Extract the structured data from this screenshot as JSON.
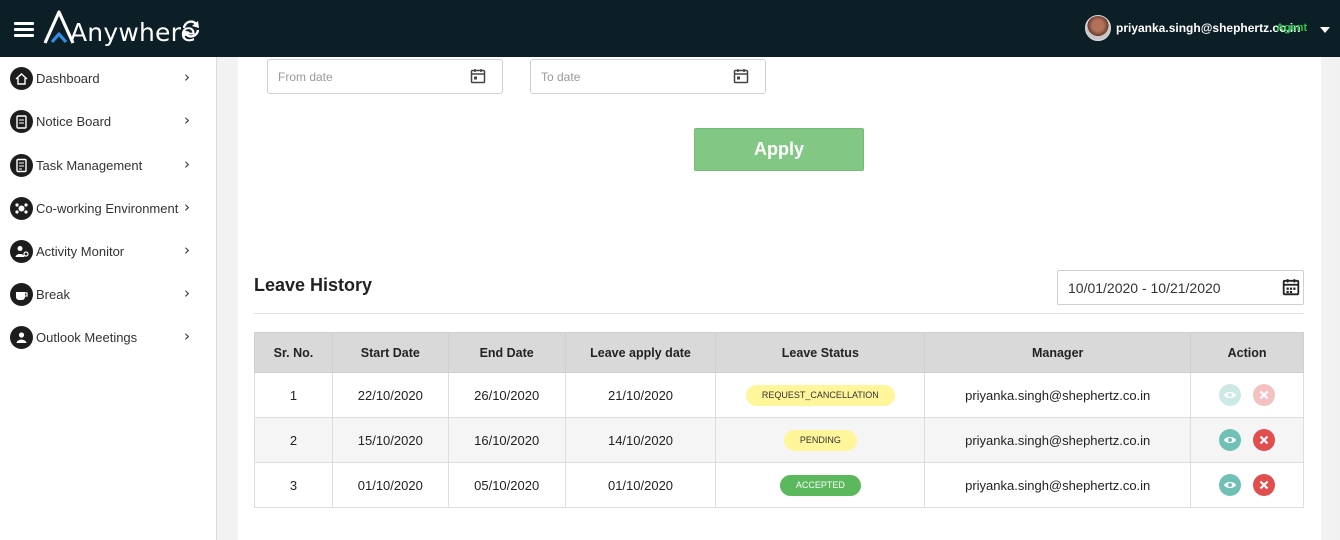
{
  "header": {
    "app_name": "Anywhere",
    "user_email": "priyanka.singh@shephertz.co.in",
    "user_role": "Agent",
    "icons": [
      "menu-icon",
      "refresh-icon",
      "caret-down-icon"
    ]
  },
  "sidebar": {
    "items": [
      {
        "label": "Dashboard",
        "icon": "home-icon"
      },
      {
        "label": "Notice Board",
        "icon": "clipboard-icon"
      },
      {
        "label": "Task Management",
        "icon": "task-icon"
      },
      {
        "label": "Co-working Environment",
        "icon": "coworking-icon"
      },
      {
        "label": "Activity Monitor",
        "icon": "activity-icon"
      },
      {
        "label": "Break",
        "icon": "coffee-icon"
      },
      {
        "label": "Outlook Meetings",
        "icon": "meetings-icon"
      }
    ]
  },
  "filters": {
    "from_placeholder": "From date",
    "to_placeholder": "To date",
    "apply_label": "Apply"
  },
  "history": {
    "title": "Leave History",
    "date_range": "10/01/2020 - 10/21/2020",
    "columns": [
      "Sr. No.",
      "Start Date",
      "End Date",
      "Leave apply date",
      "Leave Status",
      "Manager",
      "Action"
    ],
    "rows": [
      {
        "sr": "1",
        "start": "22/10/2020",
        "end": "26/10/2020",
        "applied": "21/10/2020",
        "status": "REQUEST_CANCELLATION",
        "manager": "priyanka.singh@shephertz.co.in"
      },
      {
        "sr": "2",
        "start": "15/10/2020",
        "end": "16/10/2020",
        "applied": "14/10/2020",
        "status": "PENDING",
        "manager": "priyanka.singh@shephertz.co.in"
      },
      {
        "sr": "3",
        "start": "01/10/2020",
        "end": "05/10/2020",
        "applied": "01/10/2020",
        "status": "ACCEPTED",
        "manager": "priyanka.singh@shephertz.co.in"
      }
    ]
  },
  "colors": {
    "topbar": "#0c1e26",
    "agent_green": "#28c94a",
    "apply_green": "#82c784",
    "badge_yellow": "#fff59a",
    "badge_green": "#5cb85c",
    "view_teal": "#6fc1b6",
    "delete_red": "#e04e4e"
  }
}
